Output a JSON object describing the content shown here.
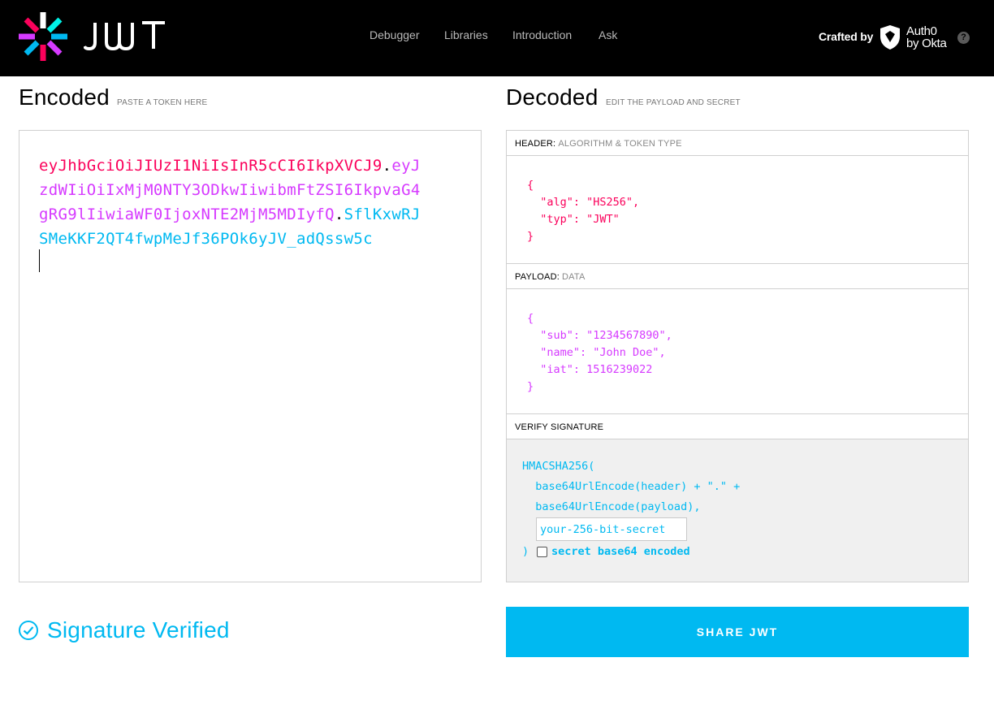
{
  "brand": {
    "name": "JWT",
    "logo_icon": "jwt-flower-logo-icon"
  },
  "nav": {
    "items": [
      "Debugger",
      "Libraries",
      "Introduction",
      "Ask"
    ]
  },
  "crafted": {
    "label": "Crafted by",
    "partner_line1": "Auth0",
    "partner_line2": "by Okta",
    "help": "?"
  },
  "encoded": {
    "title": "Encoded",
    "subtitle": "PASTE A TOKEN HERE",
    "token_header": "eyJhbGciOiJIUzI1NiIsInR5cCI6IkpXVCJ9",
    "token_payload": "eyJzdWIiOiIxMjM0NTY3ODkwIiwibmFtZSI6IkpvaG4gRG9lIiwiaWF0IjoxNTE2MjM5MDIyfQ",
    "token_signature": "SflKxwRJSMeKKF2QT4fwpMeJf36POk6yJV_adQssw5c",
    "dot": "."
  },
  "decoded": {
    "title": "Decoded",
    "subtitle": "EDIT THE PAYLOAD AND SECRET",
    "header_label": "HEADER:",
    "header_muted": "ALGORITHM & TOKEN TYPE",
    "header_lines": [
      "{",
      "  \"alg\": \"HS256\",",
      "  \"typ\": \"JWT\"",
      "}"
    ],
    "payload_label": "PAYLOAD:",
    "payload_muted": "DATA",
    "payload_lines": [
      "{",
      "  \"sub\": \"1234567890\",",
      "  \"name\": \"John Doe\",",
      "  \"iat\": 1516239022",
      "}"
    ],
    "verify_label": "VERIFY SIGNATURE",
    "sig_line1": "HMACSHA256(",
    "sig_line2": "  base64UrlEncode(header) + \".\" +",
    "sig_line3": "  base64UrlEncode(payload),",
    "secret_placeholder": "your-256-bit-secret",
    "sig_close": ")",
    "base64_label": "secret base64 encoded"
  },
  "status": {
    "text": "Signature Verified",
    "icon": "check-circle-icon"
  },
  "share": {
    "label": "SHARE JWT"
  },
  "colors": {
    "header": "#fb015b",
    "payload": "#d63aff",
    "signature": "#00b9f1"
  }
}
